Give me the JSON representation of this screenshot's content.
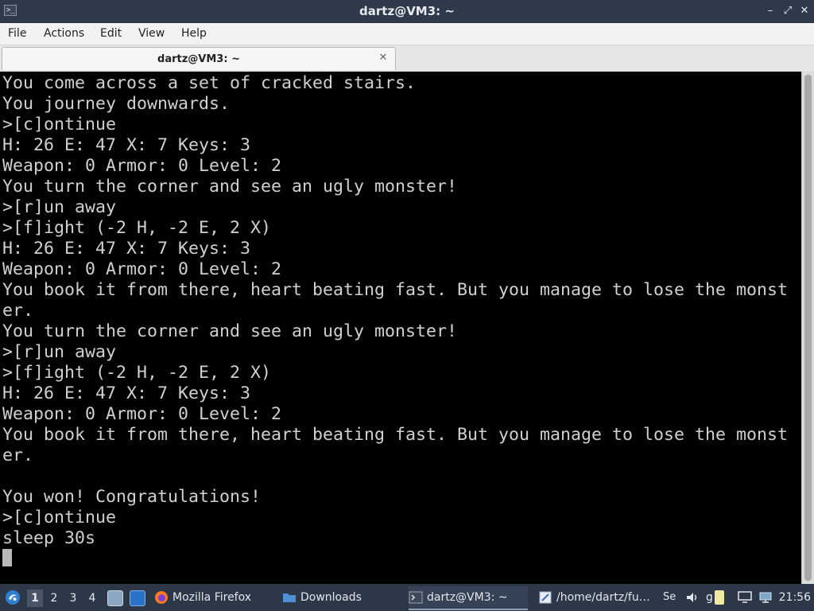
{
  "window": {
    "title": "dartz@VM3: ~",
    "term_icon_glyph": ">_",
    "controls": {
      "minimize": "–",
      "maximize": "⤢",
      "close": "✕"
    }
  },
  "menubar": {
    "items": [
      {
        "label": "File"
      },
      {
        "label": "Actions"
      },
      {
        "label": "Edit"
      },
      {
        "label": "View"
      },
      {
        "label": "Help"
      }
    ]
  },
  "tabs": [
    {
      "label": "dartz@VM3: ~",
      "close_glyph": "✕"
    }
  ],
  "terminal": {
    "lines": [
      "You come across a set of cracked stairs.",
      "You journey downwards.",
      ">[c]ontinue",
      "H: 26 E: 47 X: 7 Keys: 3",
      "Weapon: 0 Armor: 0 Level: 2",
      "You turn the corner and see an ugly monster!",
      ">[r]un away",
      ">[f]ight (-2 H, -2 E, 2 X)",
      "H: 26 E: 47 X: 7 Keys: 3",
      "Weapon: 0 Armor: 0 Level: 2",
      "You book it from there, heart beating fast. But you manage to lose the monst",
      "er.",
      "You turn the corner and see an ugly monster!",
      ">[r]un away",
      ">[f]ight (-2 H, -2 E, 2 X)",
      "H: 26 E: 47 X: 7 Keys: 3",
      "Weapon: 0 Armor: 0 Level: 2",
      "You book it from there, heart beating fast. But you manage to lose the monst",
      "er.",
      "",
      "You won! Congratulations!",
      ">[c]ontinue",
      "sleep 30s"
    ]
  },
  "taskbar": {
    "workspaces": [
      "1",
      "2",
      "3",
      "4"
    ],
    "active_workspace": "1",
    "tasks": [
      {
        "label": "Mozilla Firefox",
        "icon": "firefox-icon"
      },
      {
        "label": "Downloads",
        "icon": "folder-icon"
      },
      {
        "label": "dartz@VM3: ~",
        "icon": "terminal-icon"
      },
      {
        "label": "/home/dartz/fu…",
        "icon": "editor-icon"
      },
      {
        "label": "Se",
        "icon": "screenshot-icon"
      },
      {
        "label": "g",
        "icon": "app-icon"
      }
    ],
    "clock": "21:56"
  },
  "colors": {
    "titlebar": "#2e3a4a",
    "menubar": "#f2f2f2",
    "terminal_bg": "#000000",
    "terminal_fg": "#d0d0d0",
    "taskbar": "#2c3748"
  }
}
